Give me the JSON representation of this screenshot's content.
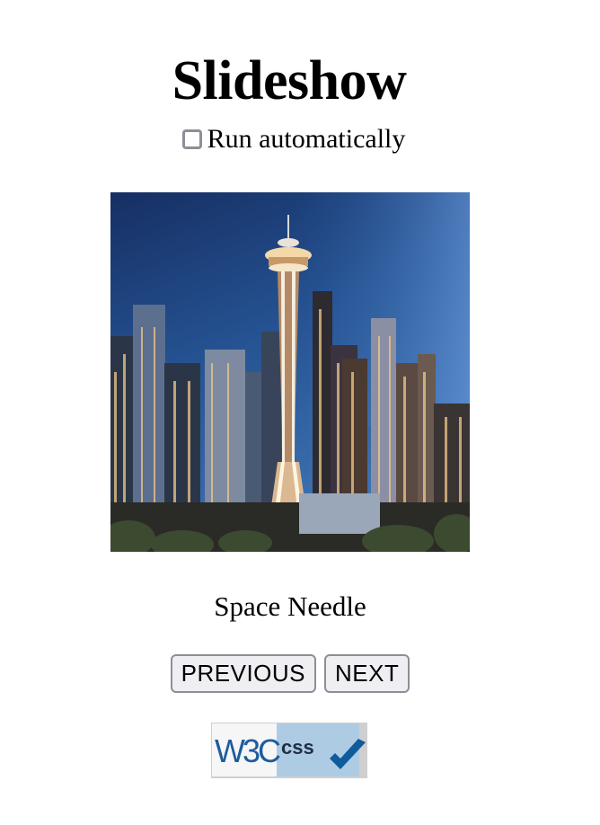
{
  "page": {
    "title": "Slideshow"
  },
  "controls": {
    "auto_label": "Run automatically",
    "auto_checked": false
  },
  "slide": {
    "caption": "Space Needle",
    "image_alt": "Space Needle"
  },
  "buttons": {
    "previous": "PREVIOUS",
    "next": "NEXT"
  },
  "badge": {
    "w3c_text": "W3C",
    "css_text": "css",
    "icon": "checkmark-icon"
  },
  "colors": {
    "sky_top": "#1c3f7e",
    "sky_bottom": "#3a6fb2",
    "button_bg": "#efeff3",
    "button_border": "#8e8e96",
    "badge_blue": "#0f5b9c"
  }
}
